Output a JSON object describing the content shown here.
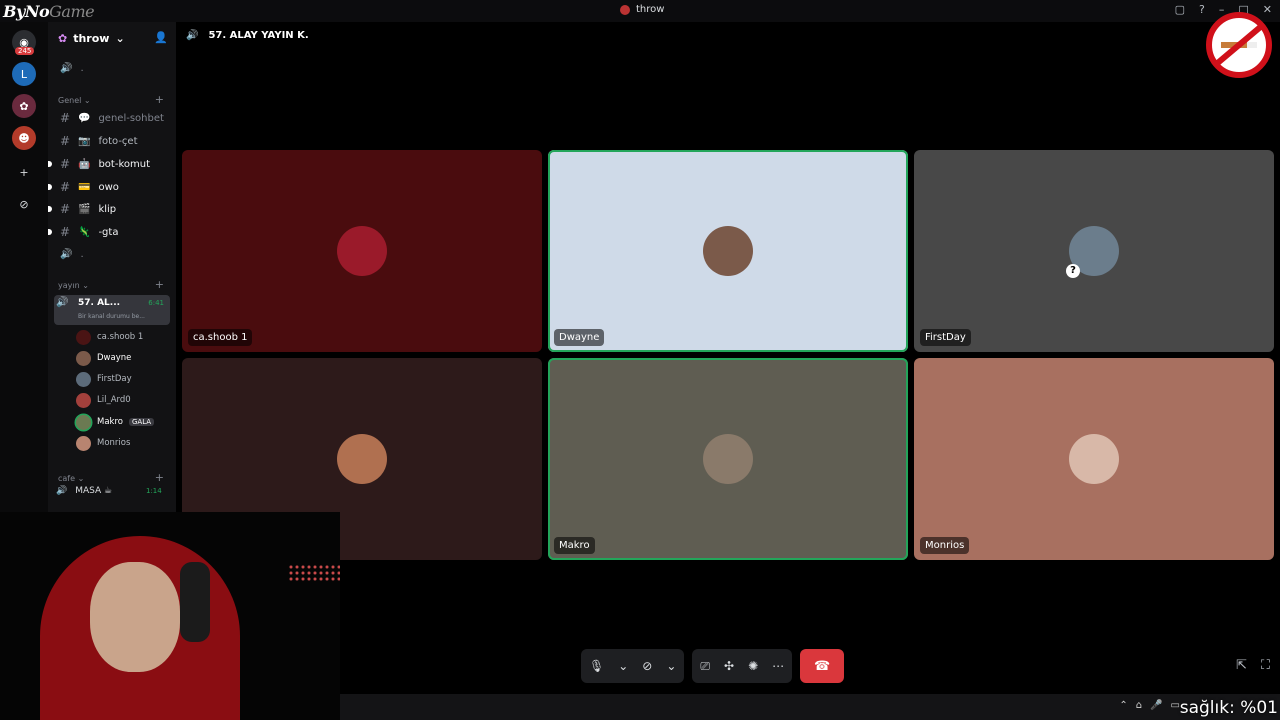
{
  "window": {
    "title": "throw"
  },
  "watermark": {
    "part_a": "ByNo",
    "part_b": "Game"
  },
  "rail": {
    "badge": "245"
  },
  "server": {
    "name": "throw"
  },
  "categories": {
    "genel": "Genel",
    "yayin": "yayın",
    "cafe": "cafe"
  },
  "channels": [
    {
      "name": "genel-sohbet",
      "prefix": "💬"
    },
    {
      "name": "foto-çet",
      "prefix": "📷"
    },
    {
      "name": "bot-komut",
      "prefix": "🤖"
    },
    {
      "name": "owo",
      "prefix": "💳"
    },
    {
      "name": "klip",
      "prefix": "🎬"
    },
    {
      "name": "-gta",
      "prefix": "🦎"
    }
  ],
  "voice": {
    "active_name": "57. AL...",
    "active_time": "6:41",
    "active_sub": "Bir kanal durumu be...",
    "masa_name": "MASA ☕",
    "masa_time": "1:14"
  },
  "members": [
    {
      "name": "ca.shoob 1",
      "tag": "",
      "color": "#4a1414"
    },
    {
      "name": "Dwayne",
      "tag": "",
      "color": "#7b5a4a"
    },
    {
      "name": "FirstDay",
      "tag": "",
      "color": "#5c6b7a"
    },
    {
      "name": "Lil_Ard0",
      "tag": "",
      "color": "#a3403c"
    },
    {
      "name": "Makro",
      "tag": "GALA",
      "color": "#6b7a52"
    },
    {
      "name": "Monrios",
      "tag": "",
      "color": "#b88470"
    }
  ],
  "main": {
    "channel_title": "57. ALAY YAYIN K."
  },
  "tiles": [
    {
      "name": "ca.shoob 1",
      "bg": "#4a0c0e",
      "avatar": "#9a1a2a",
      "speaking": false
    },
    {
      "name": "Dwayne",
      "bg": "#cfdae8",
      "avatar": "#7b5a4a",
      "speaking": true
    },
    {
      "name": "FirstDay",
      "bg": "#484848",
      "avatar": "#6b7d8c",
      "speaking": false
    },
    {
      "name": "",
      "bg": "#2d1a1a",
      "avatar": "#b07050",
      "speaking": false
    },
    {
      "name": "Makro",
      "bg": "#5f5d52",
      "avatar": "#8a7a6a",
      "speaking": true
    },
    {
      "name": "Monrios",
      "bg": "#a87060",
      "avatar": "#d8b8a8",
      "speaking": false
    }
  ],
  "overlay": {
    "health": "sağlık: %01"
  },
  "colors": {
    "speaking": "#23a55a",
    "end_call": "#da373c"
  }
}
